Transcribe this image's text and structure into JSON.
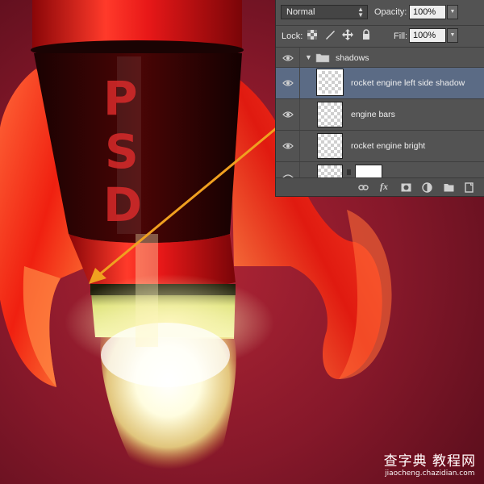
{
  "canvas": {
    "rocket_text": [
      "P",
      "S",
      "D"
    ],
    "colors": {
      "background": "#7a1525",
      "rocket_red": "#e0161a",
      "flame": "#fffbd4",
      "arrow": "#f0a020",
      "selection": "#5b6b85"
    }
  },
  "layers_panel": {
    "blend_mode": "Normal",
    "opacity_label": "Opacity:",
    "opacity_value": "100%",
    "lock_label": "Lock:",
    "fill_label": "Fill:",
    "fill_value": "100%",
    "group": {
      "name": "shadows",
      "icon": "folder-icon",
      "expanded": true
    },
    "layers": [
      {
        "name": "rocket engine left side shadow",
        "selected": true,
        "visible": true
      },
      {
        "name": "engine bars",
        "selected": false,
        "visible": true
      },
      {
        "name": "rocket engine bright",
        "selected": false,
        "visible": true
      }
    ],
    "bottom_icons": [
      "link-icon",
      "fx-icon",
      "mask-icon",
      "adjustment-icon",
      "folder-icon",
      "new-layer-icon"
    ]
  },
  "watermark": {
    "line1": "查字典 教程网",
    "line2": "jiaocheng.chazidian.com"
  }
}
